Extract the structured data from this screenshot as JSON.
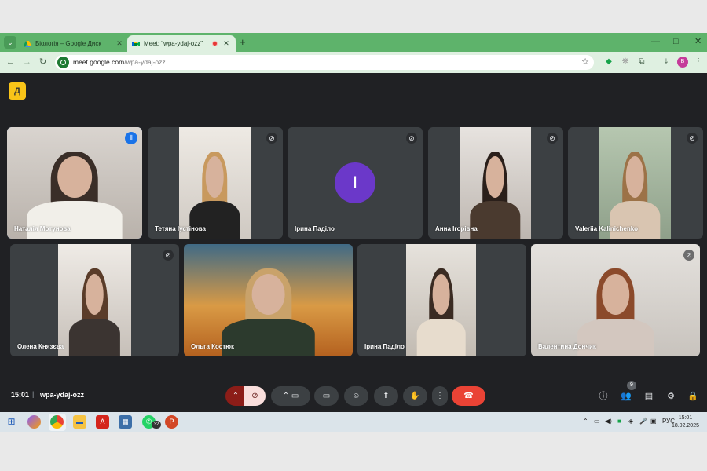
{
  "browser": {
    "tabs": [
      {
        "title": "Біологія – Google Диск",
        "active": false,
        "favicon": "google-drive-icon"
      },
      {
        "title": "Meet: \"wpa-ydaj-ozz\"",
        "active": true,
        "favicon": "google-meet-icon",
        "recording": true
      }
    ],
    "new_tab": "+",
    "url_host": "meet.google.com",
    "url_path": "/wpa-ydaj-ozz",
    "profile_initial": "B",
    "window_controls": {
      "minimize": "—",
      "maximize": "□",
      "close": "✕"
    }
  },
  "meet": {
    "logo": "Д",
    "participants": [
      {
        "name": "Наталія Мотунова",
        "muted": false,
        "speaking": true,
        "video": true
      },
      {
        "name": "Тетяна Іустінова",
        "muted": true,
        "video": true
      },
      {
        "name": "Ірина Паділо",
        "muted": true,
        "video": false,
        "initial": "I",
        "avatar_color": "#6b38c9"
      },
      {
        "name": "Анна Ігорівна",
        "muted": true,
        "video": true
      },
      {
        "name": "Valeriia Kalinichenko",
        "muted": true,
        "video": true
      },
      {
        "name": "Олена Князєва",
        "muted": true,
        "video": true
      },
      {
        "name": "Ольга Костюк",
        "muted": false,
        "video": true
      },
      {
        "name": "Ірина Паділо",
        "muted": false,
        "video": true
      },
      {
        "name": "Валентина Дончик",
        "muted": true,
        "video": true
      }
    ],
    "time": "15:01",
    "separator": "|",
    "meeting_code": "wpa-ydaj-ozz",
    "people_count": "9"
  },
  "taskbar": {
    "whatsapp_badge": "32",
    "language": "РУС",
    "time": "15:01",
    "date": "18.02.2025"
  }
}
